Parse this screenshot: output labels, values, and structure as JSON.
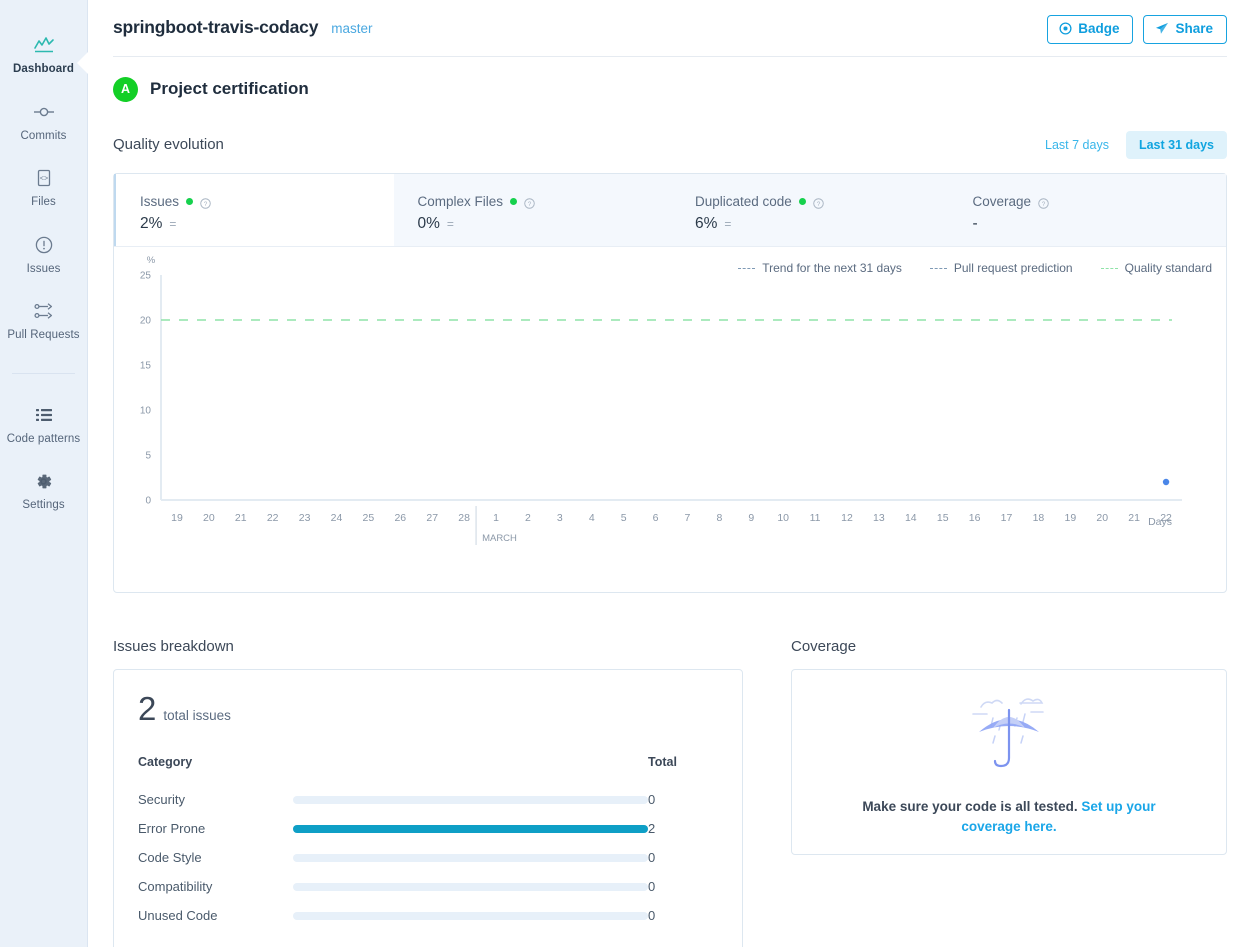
{
  "sidebar": {
    "items": [
      {
        "label": "Dashboard",
        "icon": "dashboard-chart-icon",
        "active": true
      },
      {
        "label": "Commits",
        "icon": "commit-node-icon",
        "active": false
      },
      {
        "label": "Files",
        "icon": "file-code-icon",
        "active": false
      },
      {
        "label": "Issues",
        "icon": "alert-circle-icon",
        "active": false
      },
      {
        "label": "Pull Requests",
        "icon": "pull-request-icon",
        "active": false
      }
    ],
    "items_bottom": [
      {
        "label": "Code patterns",
        "icon": "list-lines-icon",
        "active": false
      },
      {
        "label": "Settings",
        "icon": "gear-icon",
        "active": false
      }
    ]
  },
  "header": {
    "repo": "springboot-travis-codacy",
    "branch": "master",
    "badge_button": "Badge",
    "share_button": "Share"
  },
  "certification": {
    "grade": "A",
    "title": "Project certification"
  },
  "quality_evolution": {
    "title": "Quality evolution",
    "ranges": [
      {
        "label": "Last 7 days",
        "selected": false
      },
      {
        "label": "Last 31 days",
        "selected": true
      }
    ],
    "metrics": [
      {
        "name": "Issues",
        "value": "2%",
        "trend": "=",
        "has_dot": true,
        "active": true
      },
      {
        "name": "Complex Files",
        "value": "0%",
        "trend": "=",
        "has_dot": true,
        "active": false
      },
      {
        "name": "Duplicated code",
        "value": "6%",
        "trend": "=",
        "has_dot": true,
        "active": false
      },
      {
        "name": "Coverage",
        "value": "-",
        "trend": "",
        "has_dot": false,
        "active": false
      }
    ],
    "legend": [
      {
        "label": "Trend for the next 31 days",
        "color": "#7f9ab5"
      },
      {
        "label": "Pull request prediction",
        "color": "#7f9ab5"
      },
      {
        "label": "Quality standard",
        "color": "#8fe3a8"
      }
    ]
  },
  "chart_data": {
    "type": "line",
    "title": "Quality evolution",
    "xlabel": "Days",
    "ylabel": "%",
    "ylim": [
      0,
      25
    ],
    "yticks": [
      0,
      5,
      10,
      15,
      20,
      25
    ],
    "grid": false,
    "legend_position": "top-right",
    "month_label": "MARCH",
    "month_tick_index": 10,
    "categories": [
      "19",
      "20",
      "21",
      "22",
      "23",
      "24",
      "25",
      "26",
      "27",
      "28",
      "1",
      "2",
      "3",
      "4",
      "5",
      "6",
      "7",
      "8",
      "9",
      "10",
      "11",
      "12",
      "13",
      "14",
      "15",
      "16",
      "17",
      "18",
      "19",
      "20",
      "21",
      "22"
    ],
    "series": [
      {
        "name": "Issues",
        "color": "#4a86e8",
        "values": [
          null,
          null,
          null,
          null,
          null,
          null,
          null,
          null,
          null,
          null,
          null,
          null,
          null,
          null,
          null,
          null,
          null,
          null,
          null,
          null,
          null,
          null,
          null,
          null,
          null,
          null,
          null,
          null,
          null,
          null,
          null,
          2
        ]
      }
    ],
    "annotations": [
      {
        "kind": "hline",
        "name": "Quality standard",
        "y": 20,
        "color": "#8fe3a8",
        "dashed": true
      }
    ]
  },
  "issues_breakdown": {
    "title": "Issues breakdown",
    "total": "2",
    "total_label": "total issues",
    "columns": {
      "category": "Category",
      "total": "Total"
    },
    "max": 2,
    "rows": [
      {
        "category": "Security",
        "total": "0",
        "value": 0
      },
      {
        "category": "Error Prone",
        "total": "2",
        "value": 2
      },
      {
        "category": "Code Style",
        "total": "0",
        "value": 0
      },
      {
        "category": "Compatibility",
        "total": "0",
        "value": 0
      },
      {
        "category": "Unused Code",
        "total": "0",
        "value": 0
      }
    ]
  },
  "coverage": {
    "title": "Coverage",
    "message": "Make sure your code is all tested.",
    "link": "Set up your coverage here."
  },
  "colors": {
    "accent": "#17a3e0",
    "grade_green": "#13cf26",
    "bar_fill": "#0e9fc6",
    "sidebar_bg": "#eaf1f9",
    "quality_standard": "#8fe3a8",
    "point": "#4a86e8"
  }
}
